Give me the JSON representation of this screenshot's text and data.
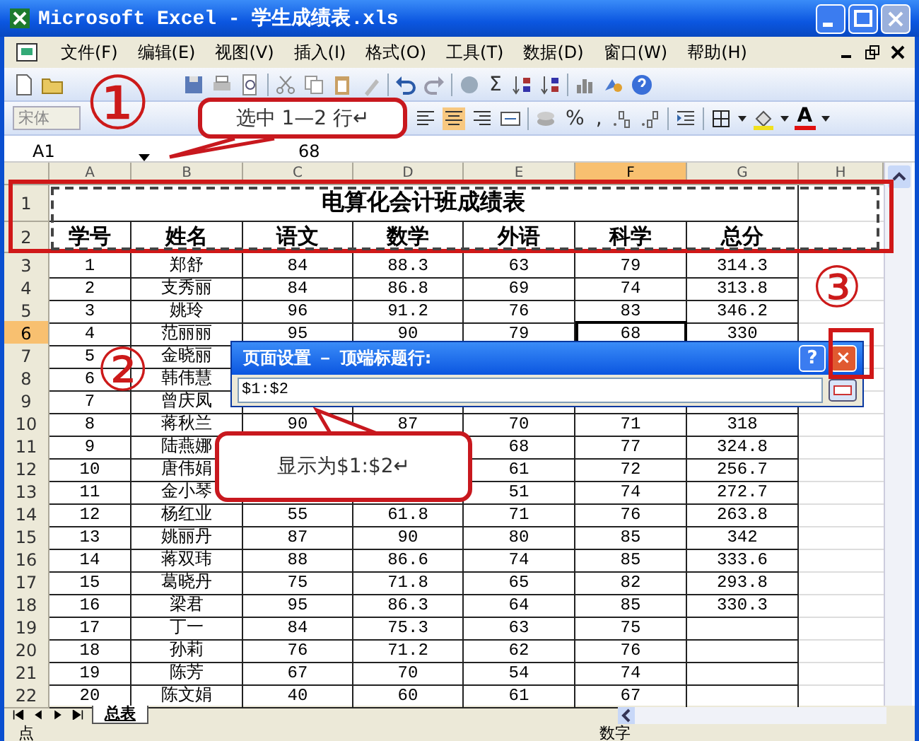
{
  "window": {
    "title": "Microsoft Excel - 学生成绩表.xls"
  },
  "menu": [
    {
      "label": "文件(F)"
    },
    {
      "label": "编辑(E)"
    },
    {
      "label": "视图(V)"
    },
    {
      "label": "插入(I)"
    },
    {
      "label": "格式(O)"
    },
    {
      "label": "工具(T)"
    },
    {
      "label": "数据(D)"
    },
    {
      "label": "窗口(W)"
    },
    {
      "label": "帮助(H)"
    }
  ],
  "toolbar": {
    "sum": "Σ",
    "font": "宋体",
    "percent": "%",
    "comma": ",",
    "font_color": "A"
  },
  "formula_bar": {
    "name_box": "A1",
    "content": "68"
  },
  "columns": [
    {
      "label": "A",
      "selected": false
    },
    {
      "label": "B",
      "selected": false
    },
    {
      "label": "C",
      "selected": false
    },
    {
      "label": "D",
      "selected": false
    },
    {
      "label": "E",
      "selected": false
    },
    {
      "label": "F",
      "selected": true
    },
    {
      "label": "G",
      "selected": false
    },
    {
      "label": "H",
      "selected": false
    }
  ],
  "rows": [
    {
      "header": "1",
      "selected": false,
      "kind": "title",
      "cells": [
        "电算化会计班成绩表"
      ]
    },
    {
      "header": "2",
      "selected": false,
      "kind": "header",
      "cells": [
        "学号",
        "姓名",
        "语文",
        "数学",
        "外语",
        "科学",
        "总分"
      ]
    },
    {
      "header": "3",
      "selected": false,
      "kind": "data",
      "cells": [
        "1",
        "郑舒",
        "84",
        "88.3",
        "63",
        "79",
        "314.3"
      ]
    },
    {
      "header": "4",
      "selected": false,
      "kind": "data",
      "cells": [
        "2",
        "支秀丽",
        "84",
        "86.8",
        "69",
        "74",
        "313.8"
      ]
    },
    {
      "header": "5",
      "selected": false,
      "kind": "data",
      "cells": [
        "3",
        "姚玲",
        "96",
        "91.2",
        "76",
        "83",
        "346.2"
      ]
    },
    {
      "header": "6",
      "selected": true,
      "kind": "data",
      "cells": [
        "4",
        "范丽丽",
        "95",
        "90",
        "79",
        "68",
        "330"
      ]
    },
    {
      "header": "7",
      "selected": false,
      "kind": "data",
      "cells": [
        "5",
        "金晓丽"
      ]
    },
    {
      "header": "8",
      "selected": false,
      "kind": "data",
      "cells": [
        "6",
        "韩伟慧"
      ]
    },
    {
      "header": "9",
      "selected": false,
      "kind": "data",
      "cells": [
        "7",
        "曾庆凤"
      ]
    },
    {
      "header": "10",
      "selected": false,
      "kind": "data",
      "cells": [
        "8",
        "蒋秋兰",
        "90",
        "87",
        "70",
        "71",
        "318"
      ]
    },
    {
      "header": "11",
      "selected": false,
      "kind": "data",
      "cells": [
        "9",
        "陆燕娜",
        null,
        null,
        "68",
        "77",
        "324.8"
      ]
    },
    {
      "header": "12",
      "selected": false,
      "kind": "data",
      "cells": [
        "10",
        "唐伟娟",
        null,
        null,
        "61",
        "72",
        "256.7"
      ]
    },
    {
      "header": "13",
      "selected": false,
      "kind": "data",
      "cells": [
        "11",
        "金小琴",
        null,
        null,
        "51",
        "74",
        "272.7"
      ]
    },
    {
      "header": "14",
      "selected": false,
      "kind": "data",
      "cells": [
        "12",
        "杨红业",
        "55",
        "61.8",
        "71",
        "76",
        "263.8"
      ]
    },
    {
      "header": "15",
      "selected": false,
      "kind": "data",
      "cells": [
        "13",
        "姚丽丹",
        "87",
        "90",
        "80",
        "85",
        "342"
      ]
    },
    {
      "header": "16",
      "selected": false,
      "kind": "data",
      "cells": [
        "14",
        "蒋双玮",
        "88",
        "86.6",
        "74",
        "85",
        "333.6"
      ]
    },
    {
      "header": "17",
      "selected": false,
      "kind": "data",
      "cells": [
        "15",
        "葛晓丹",
        "75",
        "71.8",
        "65",
        "82",
        "293.8"
      ]
    },
    {
      "header": "18",
      "selected": false,
      "kind": "data",
      "cells": [
        "16",
        "梁君",
        "95",
        "86.3",
        "64",
        "85",
        "330.3"
      ]
    },
    {
      "header": "19",
      "selected": false,
      "kind": "data",
      "cells": [
        "17",
        "丁一",
        "84",
        "75.3",
        "63",
        "75"
      ]
    },
    {
      "header": "20",
      "selected": false,
      "kind": "data",
      "cells": [
        "18",
        "孙莉",
        "76",
        "71.2",
        "62",
        "76"
      ]
    },
    {
      "header": "21",
      "selected": false,
      "kind": "data",
      "cells": [
        "19",
        "陈芳",
        "67",
        "70",
        "54",
        "74"
      ]
    },
    {
      "header": "22",
      "selected": false,
      "kind": "data",
      "cells": [
        "20",
        "陈文娟",
        "40",
        "60",
        "61",
        "67"
      ]
    }
  ],
  "sheet_tabs": [
    {
      "label": "总表",
      "selected": true
    }
  ],
  "status_bar": {
    "left": "点",
    "mode": "数字"
  },
  "dialog": {
    "title": "页面设置 － 顶端标题行:",
    "value": "$1:$2",
    "help": "?",
    "close": "×"
  },
  "callouts": [
    {
      "text": "选中 1—2 行↵"
    },
    {
      "text": "显示为$1:$2↵"
    }
  ],
  "markers": [
    "①",
    "②",
    "③"
  ]
}
